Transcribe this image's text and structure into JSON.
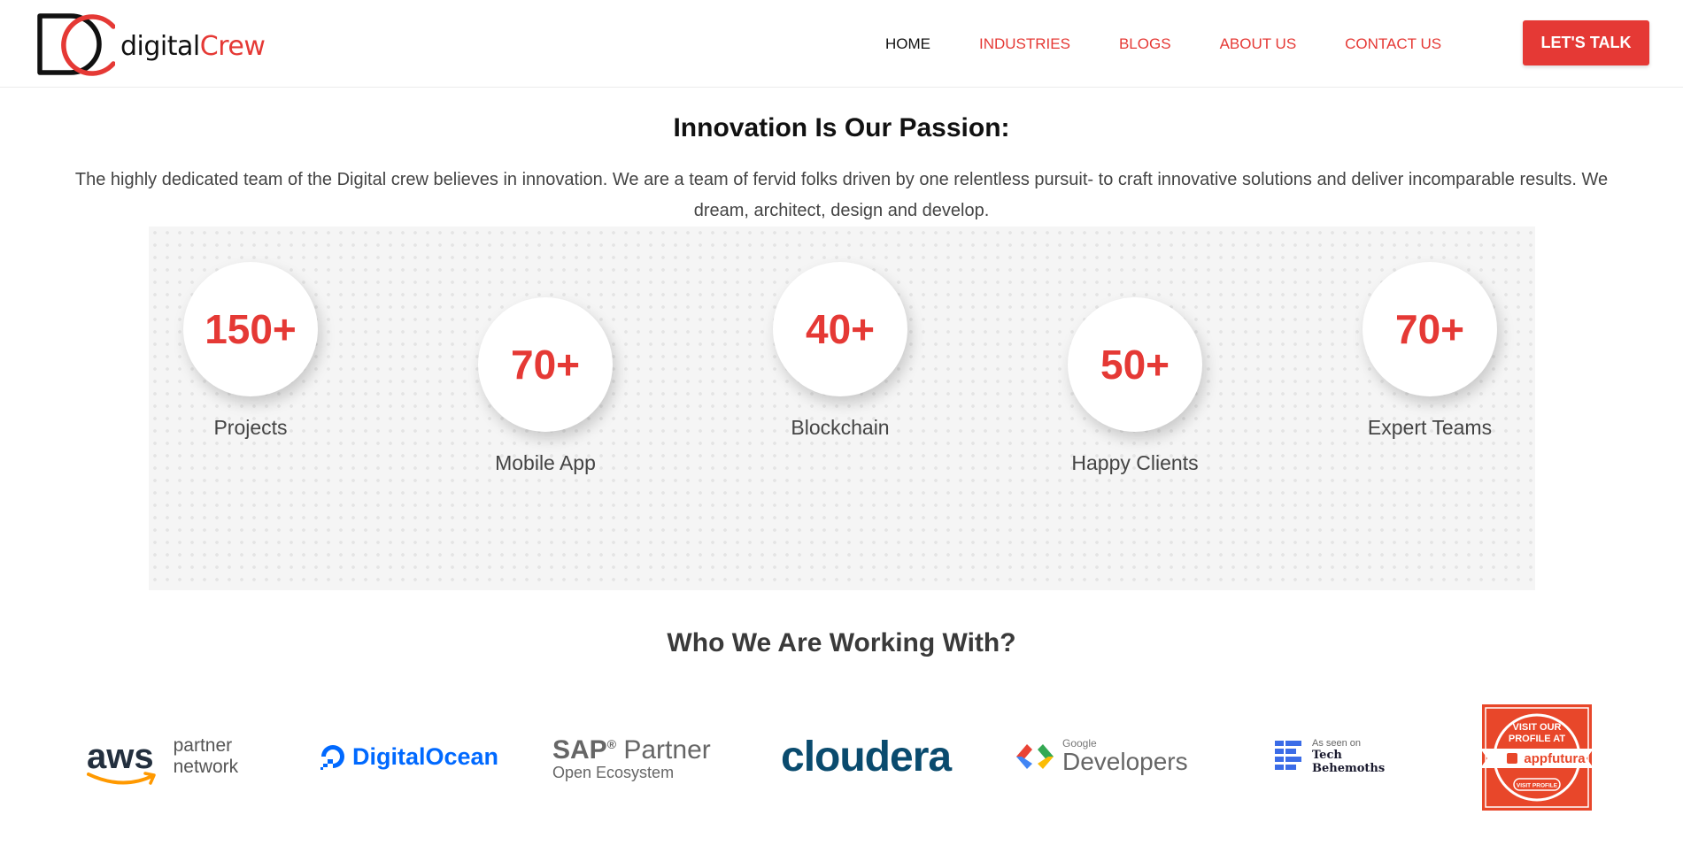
{
  "brand": {
    "name_prefix": "digital",
    "name_accent": "Crew"
  },
  "nav": {
    "items": [
      {
        "label": "HOME",
        "active": true
      },
      {
        "label": "INDUSTRIES",
        "active": false
      },
      {
        "label": "BLOGS",
        "active": false
      },
      {
        "label": "ABOUT US",
        "active": false
      },
      {
        "label": "CONTACT US",
        "active": false
      }
    ],
    "cta_label": "LET'S TALK"
  },
  "intro": {
    "title": "Innovation Is Our Passion:",
    "text": "The highly dedicated team of the Digital crew believes in innovation. We are a team of fervid folks driven by one relentless pursuit- to craft innovative solutions and deliver incomparable results. We dream, architect, design and develop."
  },
  "stats": [
    {
      "value": "150+",
      "label": "Projects"
    },
    {
      "value": "70+",
      "label": "Mobile App"
    },
    {
      "value": "40+",
      "label": "Blockchain"
    },
    {
      "value": "50+",
      "label": "Happy Clients"
    },
    {
      "value": "70+",
      "label": "Expert Teams"
    }
  ],
  "partners": {
    "title": "Who We Are Working With?",
    "aws": {
      "word": "aws",
      "line1": "partner",
      "line2": "network"
    },
    "digitalocean": {
      "name": "DigitalOcean"
    },
    "sap": {
      "brand": "SAP",
      "reg": "®",
      "word": "Partner",
      "sub": "Open Ecosystem"
    },
    "cloudera": {
      "name": "cloudera"
    },
    "google_dev": {
      "small": "Google",
      "big": "Developers"
    },
    "tech_behemoths": {
      "small": "As seen on",
      "line1": "Tech",
      "line2": "Behemoths"
    },
    "appfutura": {
      "line1": "VISIT OUR",
      "line2": "PROFILE AT",
      "brand": "appfutura",
      "button": "VISIT PROFILE"
    }
  },
  "colors": {
    "accent": "#e53935",
    "text": "#444444",
    "panel": "#f5f5f5"
  }
}
